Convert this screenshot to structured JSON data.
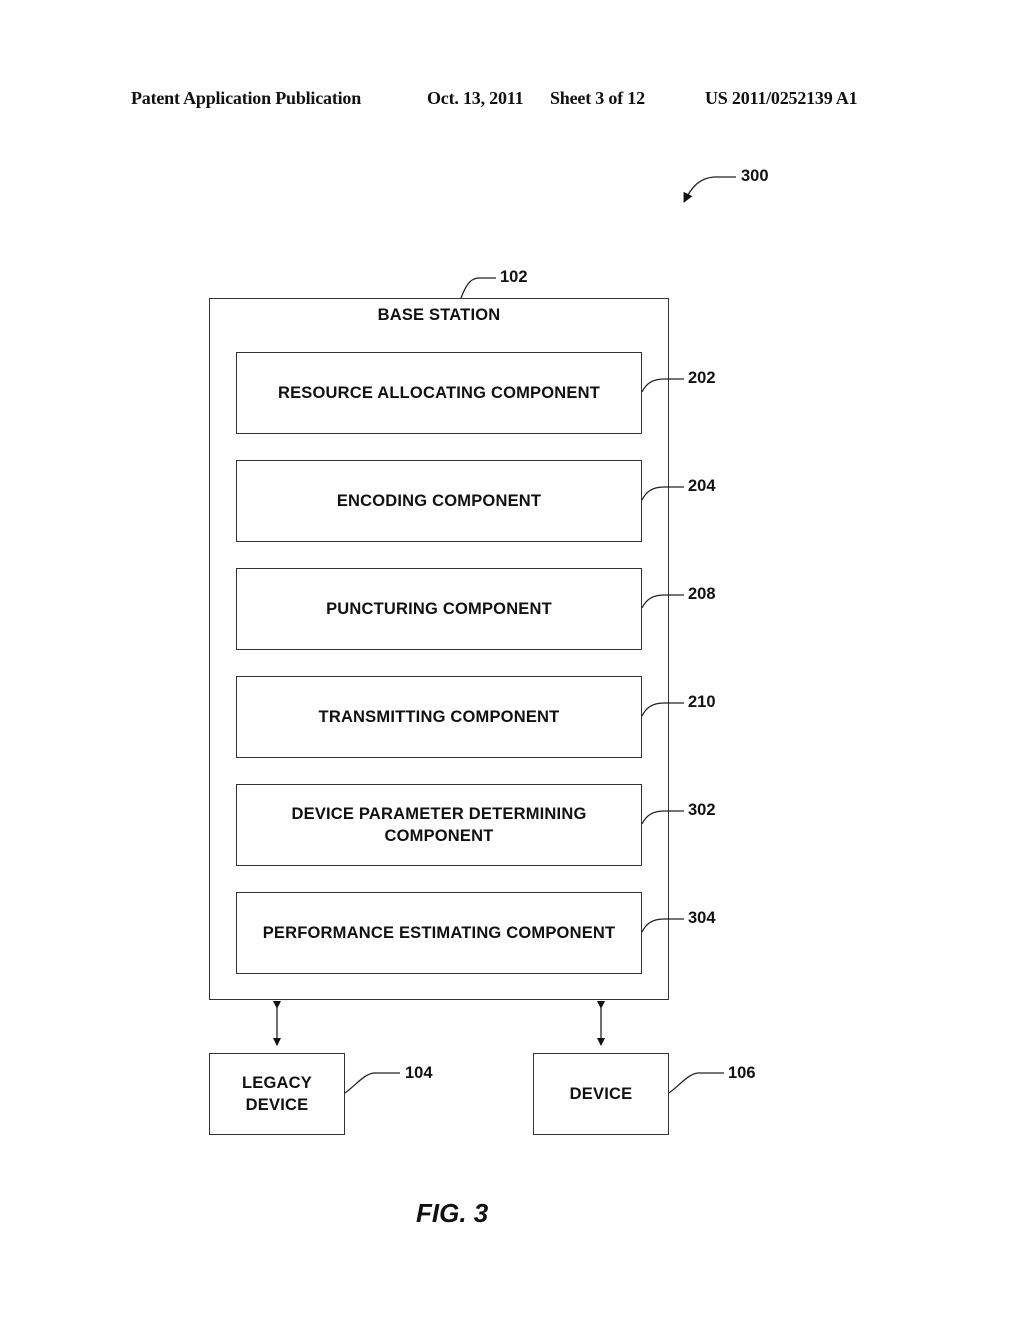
{
  "header": {
    "publication": "Patent Application Publication",
    "date": "Oct. 13, 2011",
    "sheet": "Sheet 3 of 12",
    "patent_number": "US 2011/0252139 A1"
  },
  "figure": {
    "ref": "300",
    "label": "FIG. 3"
  },
  "base_station": {
    "title": "BASE STATION",
    "ref": "102",
    "components": [
      {
        "label": "RESOURCE ALLOCATING COMPONENT",
        "ref": "202"
      },
      {
        "label": "ENCODING COMPONENT",
        "ref": "204"
      },
      {
        "label": "PUNCTURING COMPONENT",
        "ref": "208"
      },
      {
        "label": "TRANSMITTING COMPONENT",
        "ref": "210"
      },
      {
        "label": "DEVICE PARAMETER DETERMINING COMPONENT",
        "ref": "302"
      },
      {
        "label": "PERFORMANCE ESTIMATING COMPONENT",
        "ref": "304"
      }
    ]
  },
  "devices": [
    {
      "label": "LEGACY DEVICE",
      "ref": "104"
    },
    {
      "label": "DEVICE",
      "ref": "106"
    }
  ],
  "connections": [
    {
      "from": "BASE STATION",
      "to": "LEGACY DEVICE",
      "type": "bidirectional"
    },
    {
      "from": "BASE STATION",
      "to": "DEVICE",
      "type": "bidirectional"
    }
  ]
}
